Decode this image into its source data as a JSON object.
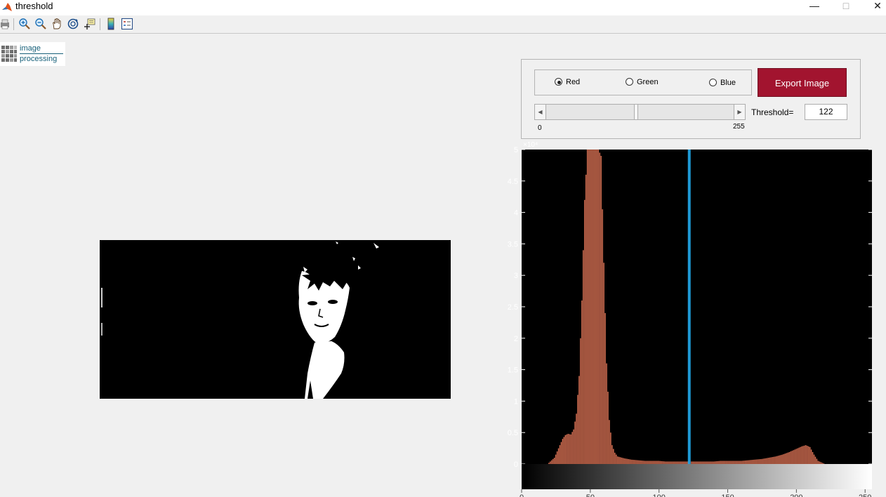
{
  "window": {
    "title": "threshold"
  },
  "logo": {
    "line1": "image",
    "line2": "processing"
  },
  "toolbar": {
    "tools": [
      "print-icon",
      "zoom-in-icon",
      "zoom-out-icon",
      "pan-icon",
      "rotate-3d-icon",
      "data-cursor-icon",
      "insert-colorbar-icon",
      "insert-legend-icon"
    ]
  },
  "controls": {
    "channels": [
      {
        "label": "Red",
        "selected": true
      },
      {
        "label": "Green",
        "selected": false
      },
      {
        "label": "Blue",
        "selected": false
      }
    ],
    "export_label": "Export Image",
    "slider": {
      "min": 0,
      "max": 255,
      "value": 122,
      "min_label": "0",
      "max_label": "255"
    },
    "threshold_label": "Threshold=",
    "threshold_value": "122"
  },
  "colors": {
    "accent_button": "#a2142f",
    "threshold_line": "#1f9ad6",
    "histogram_bars": "#e8795a",
    "logo_text": "#17607a"
  },
  "chart_data": {
    "type": "bar",
    "title": "",
    "xlabel": "",
    "ylabel": "",
    "xlim": [
      0,
      255
    ],
    "ylim": [
      0,
      5
    ],
    "y_exponent_label": "×10⁴",
    "yticks": [
      {
        "value": 0,
        "label": "0"
      },
      {
        "value": 0.5,
        "label": "0.5"
      },
      {
        "value": 1,
        "label": "1"
      },
      {
        "value": 1.5,
        "label": "1.5"
      },
      {
        "value": 2,
        "label": "2"
      },
      {
        "value": 2.5,
        "label": "2.5"
      },
      {
        "value": 3,
        "label": "3"
      },
      {
        "value": 3.5,
        "label": "3.5"
      },
      {
        "value": 4,
        "label": "4"
      },
      {
        "value": 4.5,
        "label": "4.5"
      },
      {
        "value": 5,
        "label": "5"
      }
    ],
    "xticks": [
      {
        "value": 0,
        "label": "0"
      },
      {
        "value": 50,
        "label": "50"
      },
      {
        "value": 100,
        "label": "100"
      },
      {
        "value": 150,
        "label": "150"
      },
      {
        "value": 200,
        "label": "200"
      },
      {
        "value": 250,
        "label": "250"
      }
    ],
    "threshold_x": 122,
    "bins": [
      {
        "x": 20,
        "y": 0.02
      },
      {
        "x": 24,
        "y": 0.1
      },
      {
        "x": 26,
        "y": 0.2
      },
      {
        "x": 28,
        "y": 0.3
      },
      {
        "x": 30,
        "y": 0.4
      },
      {
        "x": 32,
        "y": 0.46
      },
      {
        "x": 34,
        "y": 0.48
      },
      {
        "x": 36,
        "y": 0.47
      },
      {
        "x": 38,
        "y": 0.55
      },
      {
        "x": 40,
        "y": 0.8
      },
      {
        "x": 42,
        "y": 1.4
      },
      {
        "x": 44,
        "y": 2.6
      },
      {
        "x": 46,
        "y": 4.2
      },
      {
        "x": 48,
        "y": 5.0
      },
      {
        "x": 50,
        "y": 5.0
      },
      {
        "x": 52,
        "y": 5.0
      },
      {
        "x": 54,
        "y": 5.0
      },
      {
        "x": 56,
        "y": 5.0
      },
      {
        "x": 58,
        "y": 4.9
      },
      {
        "x": 60,
        "y": 3.2
      },
      {
        "x": 62,
        "y": 1.6
      },
      {
        "x": 64,
        "y": 0.7
      },
      {
        "x": 66,
        "y": 0.3
      },
      {
        "x": 68,
        "y": 0.18
      },
      {
        "x": 70,
        "y": 0.12
      },
      {
        "x": 75,
        "y": 0.09
      },
      {
        "x": 80,
        "y": 0.07
      },
      {
        "x": 85,
        "y": 0.06
      },
      {
        "x": 90,
        "y": 0.05
      },
      {
        "x": 95,
        "y": 0.05
      },
      {
        "x": 100,
        "y": 0.05
      },
      {
        "x": 105,
        "y": 0.04
      },
      {
        "x": 110,
        "y": 0.04
      },
      {
        "x": 115,
        "y": 0.04
      },
      {
        "x": 120,
        "y": 0.04
      },
      {
        "x": 125,
        "y": 0.04
      },
      {
        "x": 130,
        "y": 0.04
      },
      {
        "x": 135,
        "y": 0.04
      },
      {
        "x": 140,
        "y": 0.04
      },
      {
        "x": 145,
        "y": 0.05
      },
      {
        "x": 150,
        "y": 0.05
      },
      {
        "x": 155,
        "y": 0.05
      },
      {
        "x": 160,
        "y": 0.05
      },
      {
        "x": 165,
        "y": 0.06
      },
      {
        "x": 170,
        "y": 0.07
      },
      {
        "x": 175,
        "y": 0.08
      },
      {
        "x": 180,
        "y": 0.1
      },
      {
        "x": 185,
        "y": 0.12
      },
      {
        "x": 190,
        "y": 0.15
      },
      {
        "x": 195,
        "y": 0.19
      },
      {
        "x": 200,
        "y": 0.24
      },
      {
        "x": 204,
        "y": 0.28
      },
      {
        "x": 207,
        "y": 0.3
      },
      {
        "x": 210,
        "y": 0.27
      },
      {
        "x": 213,
        "y": 0.15
      },
      {
        "x": 216,
        "y": 0.05
      },
      {
        "x": 220,
        "y": 0.01
      }
    ]
  }
}
